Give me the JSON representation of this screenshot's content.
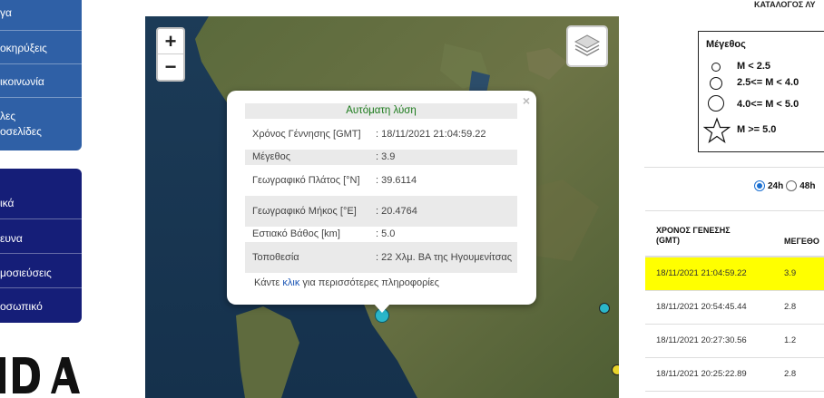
{
  "nav_primary": [
    {
      "label": "γα"
    },
    {
      "label": "οκηρύξεις"
    },
    {
      "label": "ικοινωνία"
    },
    {
      "label": "λες"
    },
    {
      "label": "οσελίδες"
    }
  ],
  "nav_secondary": [
    {
      "label": "ικά"
    },
    {
      "label": "ευνα"
    },
    {
      "label": "μοσιεύσεις"
    },
    {
      "label": "οσωπικό"
    }
  ],
  "logo_text": "ΙΔΑ",
  "map": {
    "zoom_in": "+",
    "zoom_out": "−",
    "layers_icon": "layers-icon",
    "popup": {
      "close": "×",
      "heading": "Αυτόματη λύση",
      "rows": [
        {
          "key": "Χρόνος Γέννησης [GMT]",
          "value": ": 18/11/2021 21:04:59.22"
        },
        {
          "key": "Μέγεθος",
          "value": ": 3.9"
        },
        {
          "key": "Γεωγραφικό Πλάτος [°N]",
          "value": ": 39.6114"
        },
        {
          "key": "Γεωγραφικό Μήκος [°E]",
          "value": ": 20.4764"
        },
        {
          "key": "Εστιακό Βάθος [km]",
          "value": ": 5.0"
        },
        {
          "key": "Τοποθεσία",
          "value": ": 22 Χλμ. ΒΑ της Ηγουμενίτσας"
        }
      ],
      "footer_pre": "Κάντε ",
      "footer_link": "κλικ",
      "footer_post": " για περισσότερες πληροφορίες"
    },
    "colors": {
      "quake_cyan": "#2ab6c9",
      "quake_yellow": "#e8d42a"
    }
  },
  "catalog_title": "ΚΑΤΑΛΟΓΟΣ ΛΥ",
  "legend": {
    "title": "Μέγεθος",
    "items": [
      {
        "label": "M < 2.5"
      },
      {
        "label": "2.5<= M < 4.0"
      },
      {
        "label": "4.0<= M < 5.0"
      },
      {
        "label": "M >= 5.0"
      }
    ]
  },
  "filter": {
    "opt1": "24h",
    "opt2": "48h",
    "selected": "24h"
  },
  "table": {
    "col1": "ΧΡΟΝΟΣ ΓΕΝΕΣΗΣ (GMT)",
    "col2": "ΜΕΓΕΘΟ",
    "rows": [
      {
        "time": "18/11/2021 21:04:59.22",
        "mag": "3.9",
        "highlight": true
      },
      {
        "time": "18/11/2021 20:54:45.44",
        "mag": "2.8"
      },
      {
        "time": "18/11/2021 20:27:30.56",
        "mag": "1.2"
      },
      {
        "time": "18/11/2021 20:25:22.89",
        "mag": "2.8"
      }
    ]
  },
  "colors": {
    "nav_blue": "#2f60a6",
    "nav_navy": "#151e78",
    "highlight": "#ffff00",
    "link": "#1a55b5"
  }
}
